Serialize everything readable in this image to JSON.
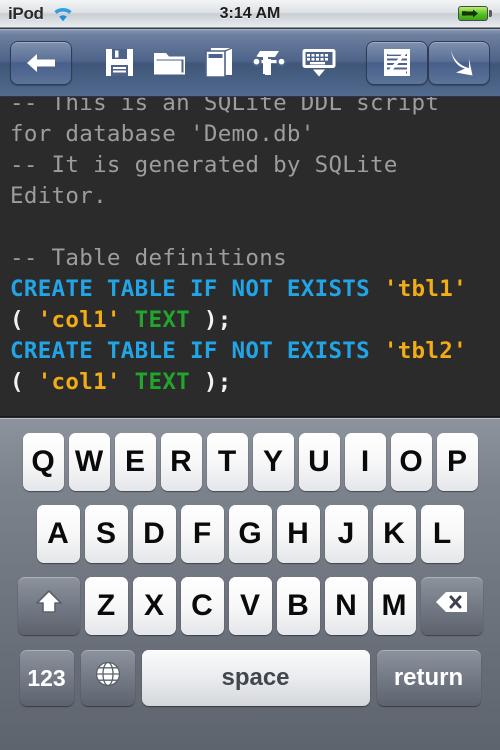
{
  "statusbar": {
    "carrier": "iPod",
    "wifi_icon": "wifi-icon",
    "time": "3:14 AM",
    "battery_icon": "battery-charging-icon"
  },
  "toolbar": {
    "buttons": [
      {
        "name": "back-button",
        "icon": "back-arrow-icon",
        "framed": true
      },
      {
        "name": "save-button",
        "icon": "floppy-disk-icon",
        "framed": false
      },
      {
        "name": "open-folder-button",
        "icon": "folder-icon",
        "framed": false
      },
      {
        "name": "database-button",
        "icon": "book-icon",
        "framed": false
      },
      {
        "name": "schema-tools-button",
        "icon": "table-wrench-icon",
        "framed": false
      },
      {
        "name": "hide-keyboard-button",
        "icon": "keyboard-dismiss-icon",
        "framed": false
      },
      {
        "name": "script-button",
        "icon": "script-document-icon",
        "framed": true
      },
      {
        "name": "execute-button",
        "icon": "diagonal-arrow-icon",
        "framed": true
      }
    ]
  },
  "editor": {
    "name": "sql-script-editor",
    "lines": [
      {
        "tokens": [
          {
            "t": "-- This is an SQLite DDL script for database 'Demo.db'",
            "k": "comment"
          }
        ]
      },
      {
        "tokens": [
          {
            "t": "-- It is generated by SQLite Editor.",
            "k": "comment"
          }
        ]
      },
      {
        "tokens": [
          {
            "t": "",
            "k": "comment"
          }
        ]
      },
      {
        "tokens": [
          {
            "t": "-- Table definitions",
            "k": "comment"
          }
        ]
      },
      {
        "tokens": [
          {
            "t": "CREATE TABLE IF NOT EXISTS ",
            "k": "keyword"
          },
          {
            "t": "'tbl1'",
            "k": "string"
          },
          {
            "t": " ( ",
            "k": "punct"
          },
          {
            "t": "'col1'",
            "k": "string"
          },
          {
            "t": " ",
            "k": "punct"
          },
          {
            "t": "TEXT",
            "k": "type"
          },
          {
            "t": " );",
            "k": "punct"
          }
        ]
      },
      {
        "tokens": [
          {
            "t": "CREATE TABLE IF NOT EXISTS ",
            "k": "keyword"
          },
          {
            "t": "'tbl2'",
            "k": "string"
          },
          {
            "t": " ( ",
            "k": "punct"
          },
          {
            "t": "'col1'",
            "k": "string"
          },
          {
            "t": " ",
            "k": "punct"
          },
          {
            "t": "TEXT",
            "k": "type"
          },
          {
            "t": " );",
            "k": "punct"
          }
        ]
      }
    ],
    "colors": {
      "background": "#2b2b2b",
      "comment": "#9d9d9d",
      "keyword": "#22a5e6",
      "string": "#f3ab16",
      "type": "#21a52b",
      "punct": "#f2f2f2"
    }
  },
  "keyboard": {
    "row1": [
      "Q",
      "W",
      "E",
      "R",
      "T",
      "Y",
      "U",
      "I",
      "O",
      "P"
    ],
    "row2": [
      "A",
      "S",
      "D",
      "F",
      "G",
      "H",
      "J",
      "K",
      "L"
    ],
    "row3": [
      "Z",
      "X",
      "C",
      "V",
      "B",
      "N",
      "M"
    ],
    "shift_icon": "shift-arrow-icon",
    "backspace_icon": "backspace-icon",
    "numeric_label": "123",
    "globe_icon": "globe-icon",
    "space_label": "space",
    "return_label": "return"
  }
}
